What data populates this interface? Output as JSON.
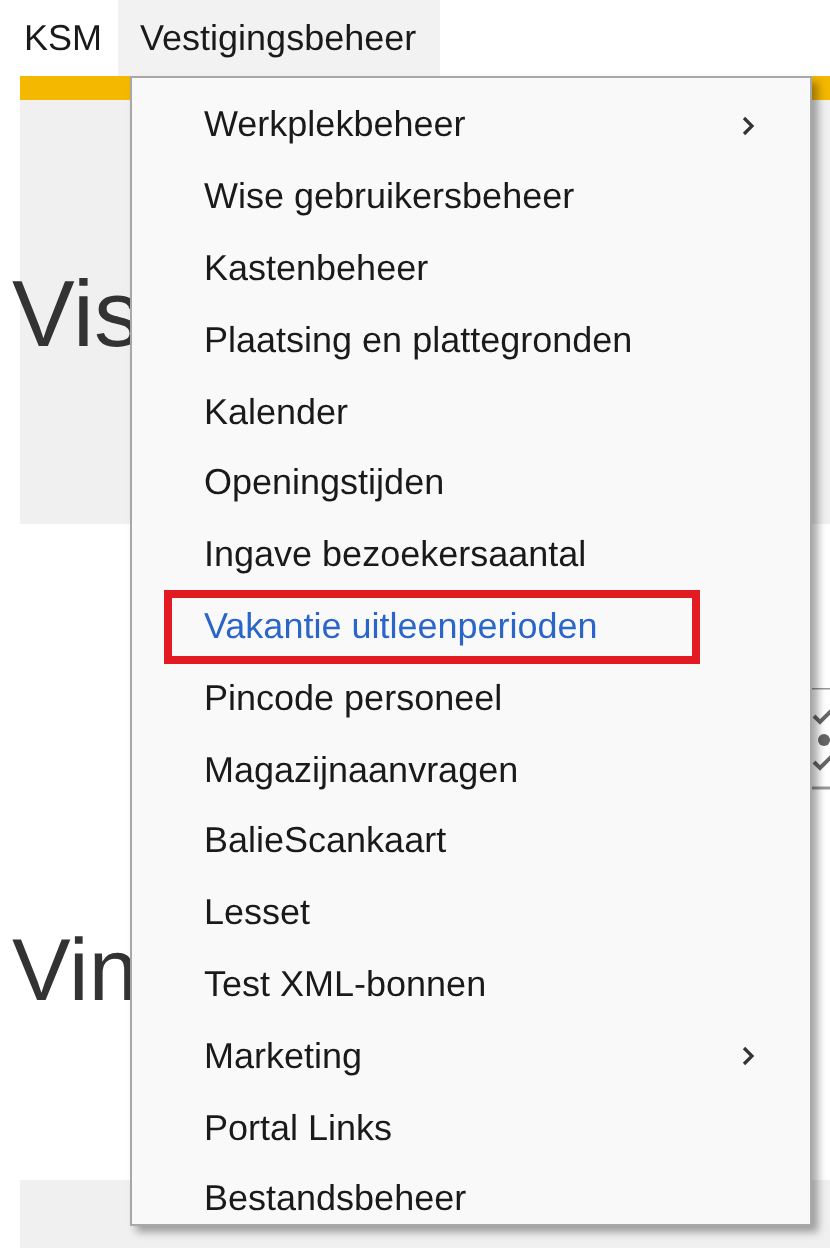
{
  "menubar": [
    {
      "label": "KSM",
      "selected": false
    },
    {
      "label": "Vestigingsbeheer",
      "selected": true
    }
  ],
  "background": {
    "heading_1": "Vis",
    "heading_2": "Vin"
  },
  "menu": [
    {
      "label": "Werkplekbeheer",
      "submenu": true,
      "selected": false
    },
    {
      "label": "Wise gebruikersbeheer",
      "submenu": false,
      "selected": false
    },
    {
      "label": "Kastenbeheer",
      "submenu": false,
      "selected": false
    },
    {
      "label": "Plaatsing en plattegronden",
      "submenu": false,
      "selected": false
    },
    {
      "label": "Kalender",
      "submenu": false,
      "selected": false
    },
    {
      "label": "Openingstijden",
      "submenu": false,
      "selected": false
    },
    {
      "label": "Ingave bezoekersaantal",
      "submenu": false,
      "selected": false
    },
    {
      "label": "Vakantie uitleenperioden",
      "submenu": false,
      "selected": true
    },
    {
      "label": "Pincode personeel",
      "submenu": false,
      "selected": false
    },
    {
      "label": "Magazijnaanvragen",
      "submenu": false,
      "selected": false
    },
    {
      "label": "BalieScankaart",
      "submenu": false,
      "selected": false
    },
    {
      "label": "Lesset",
      "submenu": false,
      "selected": false
    },
    {
      "label": "Test XML-bonnen",
      "submenu": false,
      "selected": false
    },
    {
      "label": "Marketing",
      "submenu": true,
      "selected": false
    },
    {
      "label": "Portal Links",
      "submenu": false,
      "selected": false
    },
    {
      "label": "Bestandsbeheer",
      "submenu": false,
      "selected": false
    }
  ]
}
